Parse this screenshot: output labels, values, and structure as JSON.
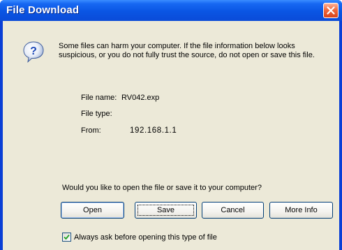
{
  "window": {
    "title": "File Download"
  },
  "message": "Some files can harm your computer. If the file information below looks suspicious, or you do not fully trust the source, do not open or save this file.",
  "file_info": {
    "name_label": "File name:",
    "name_value": "RV042.exp",
    "type_label": "File type:",
    "type_value": "",
    "from_label": "From:",
    "from_value": "192.168.1.1"
  },
  "question": "Would you like to open the file or save it to your computer?",
  "buttons": {
    "open": "Open",
    "save": "Save",
    "cancel": "Cancel",
    "more_info": "More Info"
  },
  "checkbox": {
    "label": "Always ask before opening this type of file",
    "checked": true
  },
  "icons": {
    "dialog_icon": "question-icon",
    "close_icon": "close-icon",
    "check_icon": "check-icon"
  },
  "colors": {
    "titlebar": "#0a55e3",
    "close": "#e5552a",
    "dialog_bg": "#ece9d8",
    "button_border": "#003c74"
  }
}
